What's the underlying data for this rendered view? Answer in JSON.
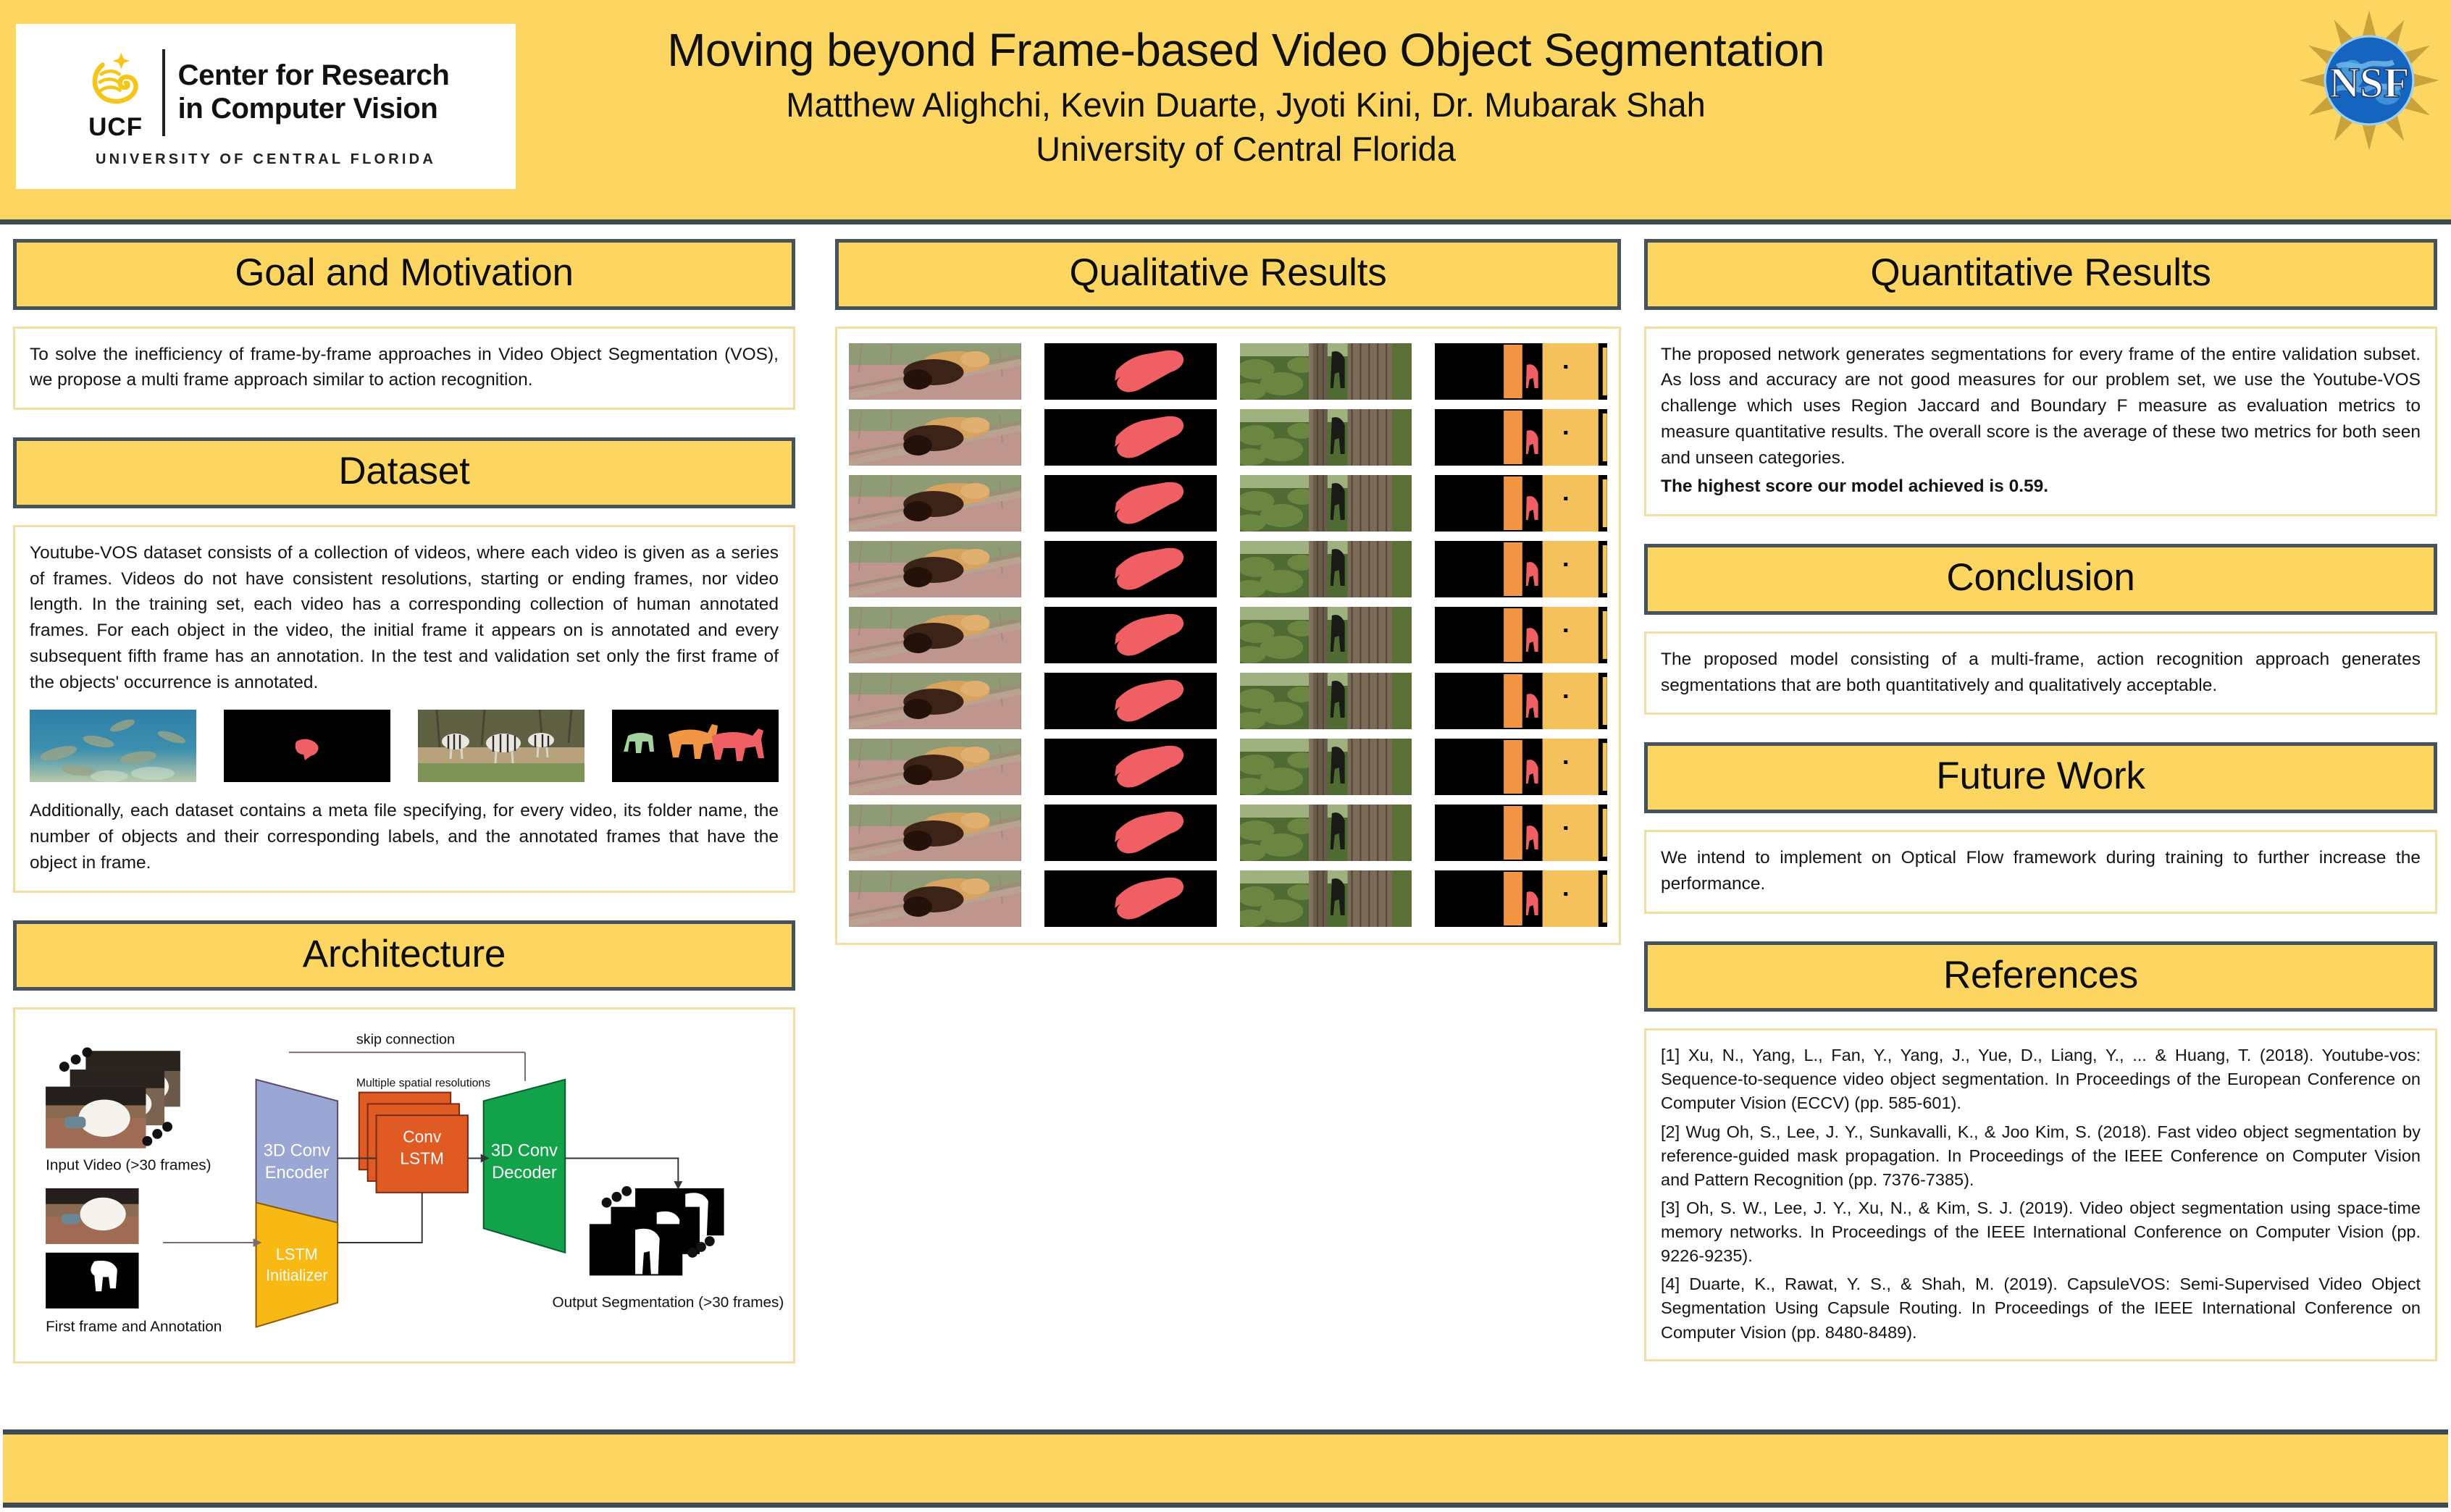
{
  "header": {
    "title": "Moving beyond Frame-based Video Object Segmentation",
    "authors": "Matthew Alighchi, Kevin Duarte, Jyoti Kini, Dr. Mubarak Shah",
    "affiliation": "University of Central Florida",
    "logo": {
      "abbrev": "UCF",
      "line1": "Center for Research",
      "line2": "in Computer Vision",
      "subtitle": "UNIVERSITY OF CENTRAL FLORIDA"
    },
    "nsf_label": "NSF"
  },
  "sections": {
    "goal": {
      "heading": "Goal and Motivation",
      "body": "To solve the inefficiency of  frame-by-frame approaches in Video Object Segmentation (VOS), we propose a multi frame approach  similar to action recognition."
    },
    "dataset": {
      "heading": "Dataset",
      "body1": "Youtube-VOS dataset consists of a collection of videos, where each video is given as a series of frames. Videos do not have consistent resolutions, starting or ending frames, nor video length. In the training set, each video has a corresponding collection of human annotated frames. For each object in the video, the initial frame it appears on is annotated and every subsequent fifth frame has an annotation. In the test and validation set only the first frame of the objects' occurrence is annotated.",
      "body2": "Additionally, each dataset contains a meta file specifying, for every video, its folder name, the number of objects and their corresponding labels, and the annotated frames that have the object in frame.",
      "samples": [
        {
          "name": "fish-underwater-frame",
          "kind": "photo"
        },
        {
          "name": "fish-annotation-mask",
          "kind": "mask"
        },
        {
          "name": "zebras-frame",
          "kind": "photo"
        },
        {
          "name": "zebras-annotation-mask",
          "kind": "mask"
        }
      ]
    },
    "architecture": {
      "heading": "Architecture",
      "labels": {
        "skip_connection": "skip connection",
        "multi_res": "Multiple spatial resolutions",
        "encoder_l1": "3D Conv",
        "encoder_l2": "Encoder",
        "convlstm_l1": "Conv",
        "convlstm_l2": "LSTM",
        "decoder_l1": "3D Conv",
        "decoder_l2": "Decoder",
        "lstm_init_l1": "LSTM",
        "lstm_init_l2": "Initializer",
        "input_video": "Input Video (>30 frames)",
        "first_frame": "First frame and Annotation",
        "output_seg": "Output Segmentation (>30 frames)"
      },
      "colors": {
        "encoder": "#9aa6d4",
        "convlstm": "#e05a23",
        "decoder": "#12a24a",
        "lstm_init": "#f9b914"
      }
    },
    "qualitative": {
      "heading": "Qualitative Results",
      "rows": 9,
      "columns": 4,
      "column_kinds": [
        "bear-frame",
        "bear-mask",
        "forest-frame",
        "forest-mask"
      ]
    },
    "quantitative": {
      "heading": "Quantitative Results",
      "body": "The proposed network generates segmentations for every frame of the entire validation subset. As loss and accuracy are not good measures for our problem set, we use the Youtube-VOS challenge which uses Region Jaccard and Boundary F measure as evaluation metrics to measure quantitative results. The overall score is the average of these two metrics for both seen and unseen categories.",
      "highlight": "The highest score our model achieved is 0.59."
    },
    "conclusion": {
      "heading": "Conclusion",
      "body": "The proposed model consisting of a multi-frame, action recognition approach generates segmentations that are both quantitatively and qualitatively acceptable."
    },
    "future_work": {
      "heading": "Future Work",
      "body": "We intend to implement on Optical Flow framework during training to further increase the performance."
    },
    "references": {
      "heading": "References",
      "items": [
        "[1] Xu, N., Yang, L., Fan, Y., Yang, J., Yue, D., Liang, Y., ... & Huang, T. (2018). Youtube-vos: Sequence-to-sequence video object segmentation. In Proceedings of the European Conference on Computer Vision (ECCV) (pp. 585-601).",
        "[2] Wug Oh, S., Lee, J. Y., Sunkavalli, K., & Joo Kim, S. (2018). Fast video object segmentation by reference-guided mask propagation. In Proceedings of the IEEE Conference on Computer Vision and Pattern Recognition (pp. 7376-7385).",
        "[3] Oh, S. W., Lee, J. Y., Xu, N., & Kim, S. J. (2019). Video object segmentation using space-time memory networks. In Proceedings of the IEEE International Conference on Computer Vision (pp. 9226-9235).",
        "[4] Duarte, K., Rawat, Y. S., & Shah, M. (2019). CapsuleVOS: Semi-Supervised Video Object Segmentation Using Capsule Routing. In Proceedings of the IEEE International Conference on Computer Vision (pp. 8480-8489)."
      ]
    }
  },
  "colors": {
    "accent_yellow": "#fcd661",
    "header_border": "#3c4a54",
    "body_border": "#f2dda2",
    "mask_red": "#f05f64",
    "mask_orange": "#f29545",
    "mask_gold": "#f5c15c",
    "mask_green": "#a3d39c"
  }
}
